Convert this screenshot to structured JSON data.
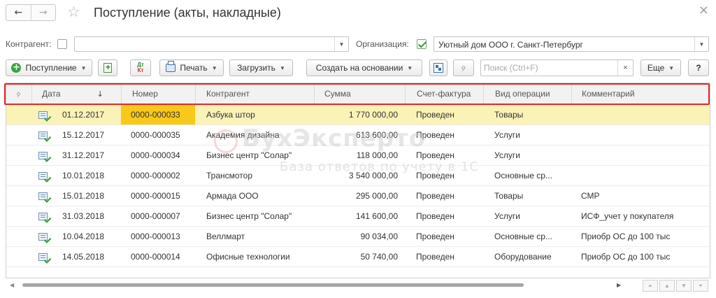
{
  "window": {
    "title": "Поступление (акты, накладные)",
    "back_icon": "←",
    "forward_icon": "→",
    "favorite_icon": "☆",
    "close_icon": "×"
  },
  "filters": {
    "counterparty_label": "Контрагент:",
    "counterparty_checked": false,
    "counterparty_value": "",
    "organization_label": "Организация:",
    "organization_checked": true,
    "organization_value": "Уютный дом ООО г. Санкт-Петербург"
  },
  "toolbar": {
    "receipt_label": "Поступление",
    "dt_label": "Дт",
    "kt_label": "Кт",
    "print_label": "Печать",
    "load_label": "Загрузить",
    "create_based_label": "Создать на основании",
    "search_placeholder": "Поиск (Ctrl+F)",
    "clear_label": "×",
    "more_label": "Еще",
    "help_label": "?"
  },
  "table": {
    "columns": {
      "date": "Дата",
      "sort_indicator": "↓",
      "number": "Номер",
      "counterparty": "Контрагент",
      "sum": "Сумма",
      "invoice": "Счет-фактура",
      "operation": "Вид операции",
      "comment": "Комментарий"
    },
    "rows": [
      {
        "date": "01.12.2017",
        "number": "0000-000033",
        "counterparty": "Азбука штор",
        "sum": "1 770 000,00",
        "invoice": "Проведен",
        "operation": "Товары",
        "comment": ""
      },
      {
        "date": "15.12.2017",
        "number": "0000-000035",
        "counterparty": "Академия дизайна",
        "sum": "613 600,00",
        "invoice": "Проведен",
        "operation": "Услуги",
        "comment": ""
      },
      {
        "date": "31.12.2017",
        "number": "0000-000034",
        "counterparty": "Бизнес центр \"Солар\"",
        "sum": "118 000,00",
        "invoice": "Проведен",
        "operation": "Услуги",
        "comment": ""
      },
      {
        "date": "10.01.2018",
        "number": "0000-000002",
        "counterparty": "Трансмотор",
        "sum": "3 540 000,00",
        "invoice": "Проведен",
        "operation": "Основные ср...",
        "comment": ""
      },
      {
        "date": "15.01.2018",
        "number": "0000-000015",
        "counterparty": "Армада ООО",
        "sum": "295 000,00",
        "invoice": "Проведен",
        "operation": "Товары",
        "comment": "СМР"
      },
      {
        "date": "31.03.2018",
        "number": "0000-000007",
        "counterparty": "Бизнес центр \"Солар\"",
        "sum": "141 600,00",
        "invoice": "Проведен",
        "operation": "Услуги",
        "comment": "ИСФ_учет у покупателя"
      },
      {
        "date": "10.04.2018",
        "number": "0000-000013",
        "counterparty": "Веллмарт",
        "sum": "90 034,00",
        "invoice": "Проведен",
        "operation": "Основные ср...",
        "comment": "Приобр ОС до 100 тыс"
      },
      {
        "date": "14.05.2018",
        "number": "0000-000014",
        "counterparty": "Офисные технологии",
        "sum": "50 740,00",
        "invoice": "Проведен",
        "operation": "Оборудование",
        "comment": "Приобр ОС до 100 тыс"
      }
    ]
  },
  "watermark": {
    "main": "БухЭксперто",
    "sub": "База ответов по учету в 1С"
  },
  "colors": {
    "selected_row": "#fbf2b8",
    "active_cell": "#f8c81a",
    "highlight_frame": "#e02727",
    "check_green": "#2e9a3a"
  },
  "icons": {
    "add": "plus-circle-icon",
    "dtkt": "dt-kt-icon",
    "print": "printer-icon",
    "structure": "document-structure-icon",
    "attachment": "paperclip-icon",
    "row_document": "posted-document-icon"
  }
}
